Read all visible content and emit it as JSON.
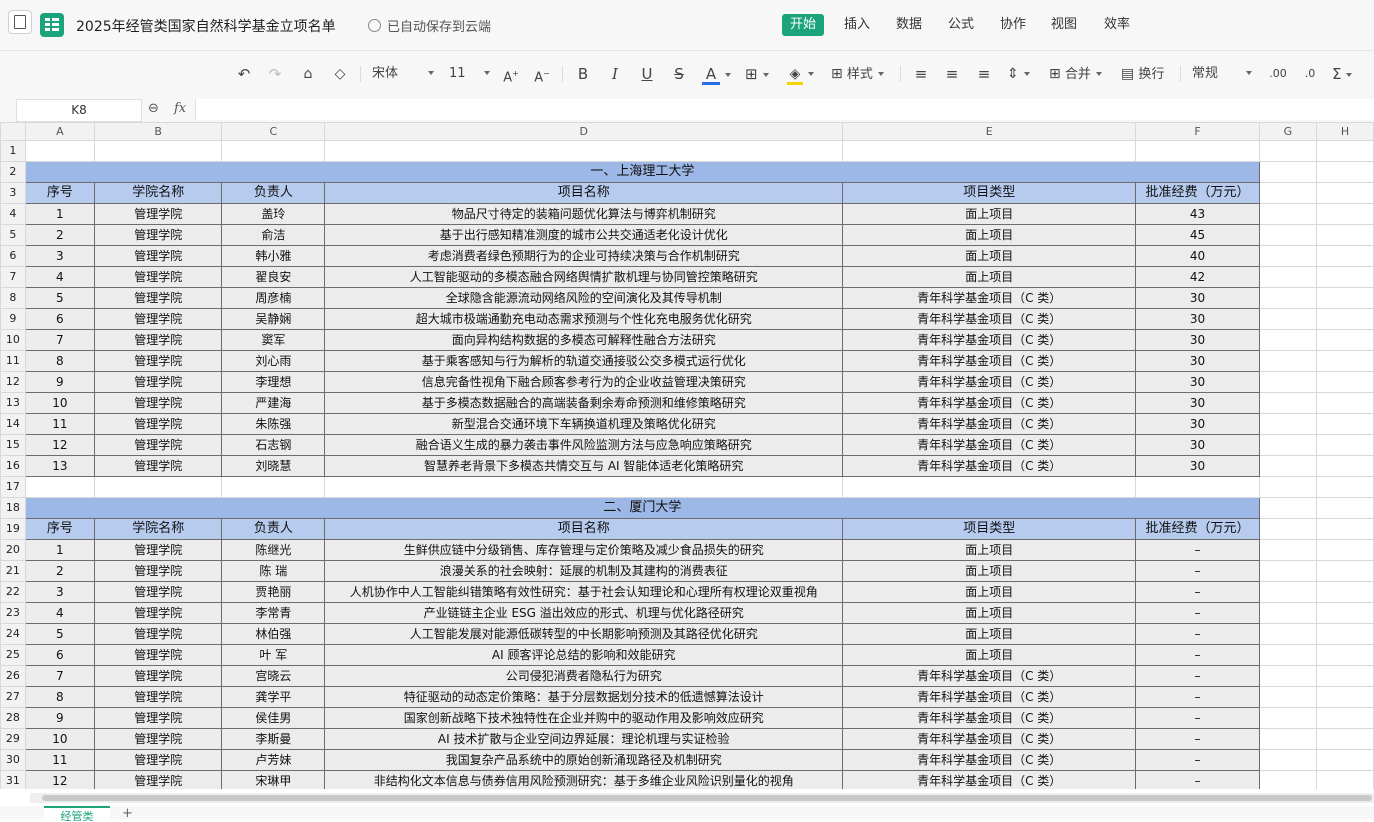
{
  "title_bar": {
    "doc_title": "2025年经管类国家自然科学基金立项名单",
    "saved_status": "已自动保存到云端",
    "menu": [
      "开始",
      "插入",
      "数据",
      "公式",
      "协作",
      "视图",
      "效率"
    ]
  },
  "toolbar": {
    "font_name": "宋体",
    "font_size": "11",
    "style_label": "样式",
    "merge_label": "合并",
    "wrap_label": "换行",
    "number_format": "常规",
    "font_color": "#2a6fe8",
    "fill_color": "#f5d400"
  },
  "formula_bar": {
    "cell_ref": "K8",
    "fx_label": "fx"
  },
  "columns": [
    "A",
    "B",
    "C",
    "D",
    "E",
    "F",
    "G",
    "H"
  ],
  "sections": [
    {
      "title": "一、上海理工大学",
      "headers": [
        "序号",
        "学院名称",
        "负责人",
        "项目名称",
        "项目类型",
        "批准经费（万元）"
      ],
      "rows": [
        [
          "1",
          "管理学院",
          "盖玲",
          "物品尺寸待定的装箱问题优化算法与博弈机制研究",
          "面上项目",
          "43"
        ],
        [
          "2",
          "管理学院",
          "俞洁",
          "基于出行感知精准测度的城市公共交通适老化设计优化",
          "面上项目",
          "45"
        ],
        [
          "3",
          "管理学院",
          "韩小雅",
          "考虑消费者绿色预期行为的企业可持续决策与合作机制研究",
          "面上项目",
          "40"
        ],
        [
          "4",
          "管理学院",
          "翟良安",
          "人工智能驱动的多模态融合网络舆情扩散机理与协同管控策略研究",
          "面上项目",
          "42"
        ],
        [
          "5",
          "管理学院",
          "周彦楠",
          "全球隐含能源流动网络风险的空间演化及其传导机制",
          "青年科学基金项目（C 类）",
          "30"
        ],
        [
          "6",
          "管理学院",
          "吴静娴",
          "超大城市极端通勤充电动态需求预测与个性化充电服务优化研究",
          "青年科学基金项目（C 类）",
          "30"
        ],
        [
          "7",
          "管理学院",
          "窦军",
          "面向异构结构数据的多模态可解释性融合方法研究",
          "青年科学基金项目（C 类）",
          "30"
        ],
        [
          "8",
          "管理学院",
          "刘心雨",
          "基于乘客感知与行为解析的轨道交通接驳公交多模式运行优化",
          "青年科学基金项目（C 类）",
          "30"
        ],
        [
          "9",
          "管理学院",
          "李理想",
          "信息完备性视角下融合顾客参考行为的企业收益管理决策研究",
          "青年科学基金项目（C 类）",
          "30"
        ],
        [
          "10",
          "管理学院",
          "严建海",
          "基于多模态数据融合的高端装备剩余寿命预测和维修策略研究",
          "青年科学基金项目（C 类）",
          "30"
        ],
        [
          "11",
          "管理学院",
          "朱陈强",
          "新型混合交通环境下车辆换道机理及策略优化研究",
          "青年科学基金项目（C 类）",
          "30"
        ],
        [
          "12",
          "管理学院",
          "石志钢",
          "融合语义生成的暴力袭击事件风险监测方法与应急响应策略研究",
          "青年科学基金项目（C 类）",
          "30"
        ],
        [
          "13",
          "管理学院",
          "刘晓慧",
          "智慧养老背景下多模态共情交互与 AI 智能体适老化策略研究",
          "青年科学基金项目（C 类）",
          "30"
        ]
      ]
    },
    {
      "title": "二、厦门大学",
      "headers": [
        "序号",
        "学院名称",
        "负责人",
        "项目名称",
        "项目类型",
        "批准经费（万元）"
      ],
      "rows": [
        [
          "1",
          "管理学院",
          "陈继光",
          "生鲜供应链中分级销售、库存管理与定价策略及减少食品损失的研究",
          "面上项目",
          "–"
        ],
        [
          "2",
          "管理学院",
          "陈 瑞",
          "浪漫关系的社会映射：延展的机制及其建构的消费表征",
          "面上项目",
          "–"
        ],
        [
          "3",
          "管理学院",
          "贾艳丽",
          "人机协作中人工智能纠错策略有效性研究：基于社会认知理论和心理所有权理论双重视角",
          "面上项目",
          "–"
        ],
        [
          "4",
          "管理学院",
          "李常青",
          "产业链链主企业 ESG 溢出效应的形式、机理与优化路径研究",
          "面上项目",
          "–"
        ],
        [
          "5",
          "管理学院",
          "林伯强",
          "人工智能发展对能源低碳转型的中长期影响预测及其路径优化研究",
          "面上项目",
          "–"
        ],
        [
          "6",
          "管理学院",
          "叶 军",
          "AI 顾客评论总结的影响和效能研究",
          "面上项目",
          "–"
        ],
        [
          "7",
          "管理学院",
          "宫晓云",
          "公司侵犯消费者隐私行为研究",
          "青年科学基金项目（C 类）",
          "–"
        ],
        [
          "8",
          "管理学院",
          "龚学平",
          "特征驱动的动态定价策略：基于分层数据划分技术的低遗憾算法设计",
          "青年科学基金项目（C 类）",
          "–"
        ],
        [
          "9",
          "管理学院",
          "侯佳男",
          "国家创新战略下技术独特性在企业并购中的驱动作用及影响效应研究",
          "青年科学基金项目（C 类）",
          "–"
        ],
        [
          "10",
          "管理学院",
          "李斯曼",
          "AI 技术扩散与企业空间边界延展：理论机理与实证检验",
          "青年科学基金项目（C 类）",
          "–"
        ],
        [
          "11",
          "管理学院",
          "卢芳妹",
          "我国复杂产品系统中的原始创新涌现路径及机制研究",
          "青年科学基金项目（C 类）",
          "–"
        ],
        [
          "12",
          "管理学院",
          "宋琳甲",
          "非结构化文本信息与债券信用风险预测研究：基于多维企业风险识别量化的视角",
          "青年科学基金项目（C 类）",
          "–"
        ]
      ]
    }
  ],
  "sheet_tabs": {
    "active": "经管类",
    "add": "+"
  }
}
